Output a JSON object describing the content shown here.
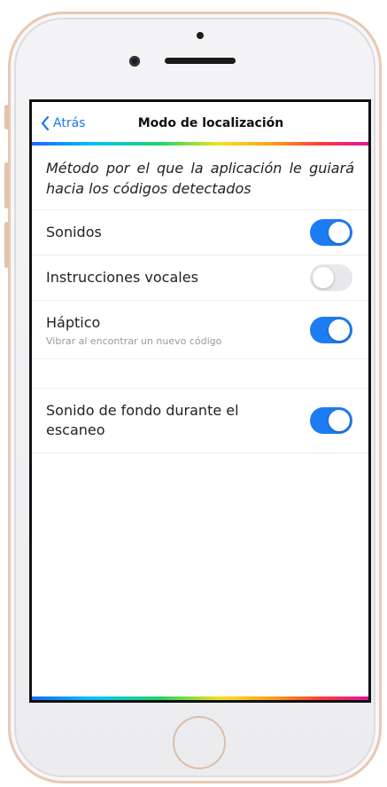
{
  "nav": {
    "back_label": "Atrás",
    "title": "Modo de localización"
  },
  "description": "Método por el que la aplicación le guiará hacia los códigos detectados",
  "settings": [
    {
      "label": "Sonidos",
      "on": true
    },
    {
      "label": "Instrucciones vocales",
      "on": false
    },
    {
      "label": "Háptico",
      "sublabel": "Vibrar al encontrar un nuevo código",
      "on": true
    },
    {
      "label": "Sonido de fondo durante el escaneo",
      "on": true
    }
  ],
  "colors": {
    "accent": "#1e7cf2",
    "toggle_off": "#e8e8ea",
    "phone_frame": "#e9c9b1"
  }
}
